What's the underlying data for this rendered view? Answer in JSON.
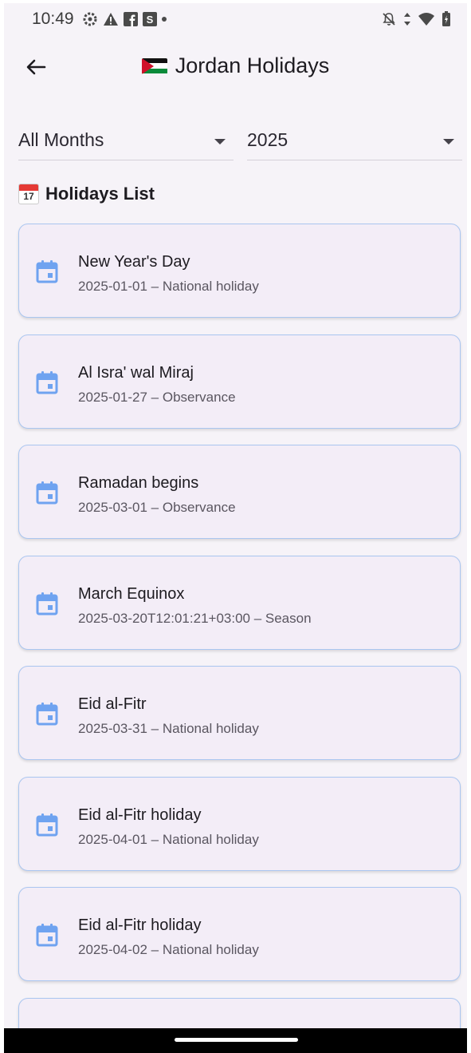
{
  "status_bar": {
    "time": "10:49",
    "s_badge": "S"
  },
  "app_bar": {
    "title": "Jordan Holidays"
  },
  "filters": {
    "month": "All Months",
    "year": "2025"
  },
  "section": {
    "emoji_number": "17",
    "title": "Holidays List"
  },
  "holidays": [
    {
      "name": "New Year's Day",
      "detail": "2025-01-01 – National holiday"
    },
    {
      "name": "Al Isra' wal Miraj",
      "detail": "2025-01-27 – Observance"
    },
    {
      "name": "Ramadan begins",
      "detail": "2025-03-01 – Observance"
    },
    {
      "name": "March Equinox",
      "detail": "2025-03-20T12:01:21+03:00 – Season"
    },
    {
      "name": "Eid al-Fitr",
      "detail": "2025-03-31 – National holiday"
    },
    {
      "name": "Eid al-Fitr holiday",
      "detail": "2025-04-01 – National holiday"
    },
    {
      "name": "Eid al-Fitr holiday",
      "detail": "2025-04-02 – National holiday"
    }
  ],
  "colors": {
    "accent": "#6fa3f0",
    "card_bg": "#f3edf7",
    "card_border": "#aac6f0"
  }
}
